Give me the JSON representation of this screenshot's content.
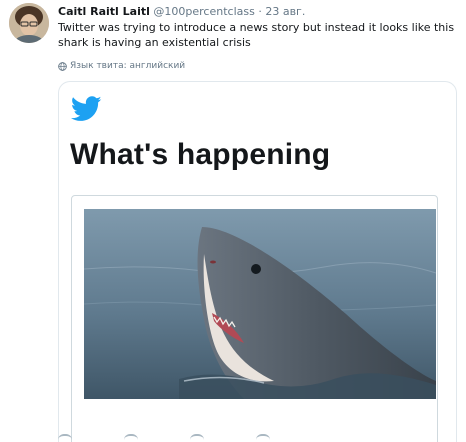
{
  "tweet": {
    "author_name": "Caitl Raitl Laitl",
    "author_handle": "@100percentclass",
    "separator": "·",
    "date": "23 авг.",
    "text": "Twitter was trying to introduce a news story but instead it looks like this shark is having an existential crisis",
    "language_label": "Язык твита: английский"
  },
  "media": {
    "headline": "What's happening",
    "image_subject": "great-white-shark"
  },
  "colors": {
    "twitter_blue": "#1da1f2",
    "text_primary": "#14171a",
    "text_secondary": "#657786"
  }
}
